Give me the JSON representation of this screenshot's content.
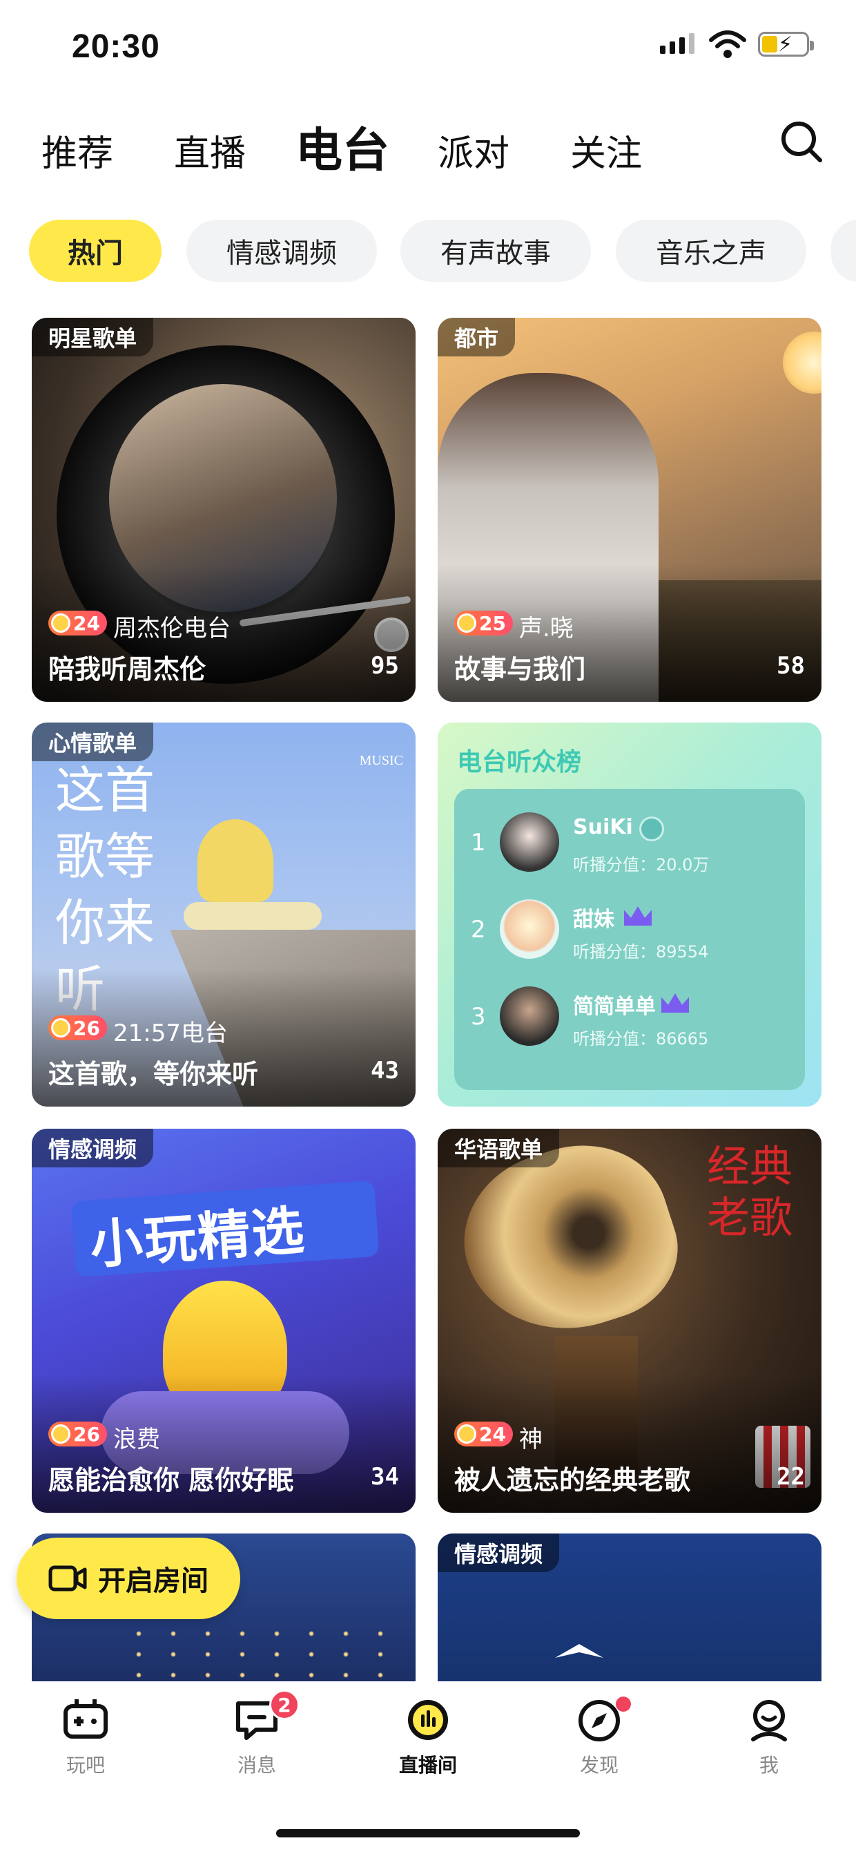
{
  "status_bar": {
    "time": "20:30"
  },
  "top_tabs": [
    {
      "label": "推荐"
    },
    {
      "label": "直播"
    },
    {
      "label": "电台"
    },
    {
      "label": "派对"
    },
    {
      "label": "关注"
    }
  ],
  "chips": [
    {
      "label": "热门"
    },
    {
      "label": "情感调频"
    },
    {
      "label": "有声故事"
    },
    {
      "label": "音乐之声"
    }
  ],
  "cards": [
    {
      "tag": "明星歌单",
      "level": "24",
      "host": "周杰伦电台",
      "title": "陪我听周杰伦",
      "count": "95"
    },
    {
      "tag": "都市",
      "level": "25",
      "host": "声.晓",
      "title": "故事与我们",
      "count": "58"
    },
    {
      "tag": "心情歌单",
      "level": "26",
      "host": "21:57电台",
      "title": "这首歌，等你来听",
      "count": "43",
      "art_text": "这首歌等你来听",
      "art_small": "MUSIC"
    },
    {
      "tag": "情感调频",
      "level": "26",
      "host": "浪费",
      "title": "愿能治愈你 愿你好眠",
      "count": "34",
      "art_text": "小玩精选"
    },
    {
      "tag": "华语歌单",
      "level": "24",
      "host": "神",
      "title": "被人遗忘的经典老歌",
      "count": "22",
      "art_text": "经典老歌"
    },
    {
      "tag": "情感调频"
    }
  ],
  "rank_card": {
    "title": "电台听众榜",
    "rows": [
      {
        "rank": "1",
        "name": "SuiKi",
        "score": "听播分值：20.0万"
      },
      {
        "rank": "2",
        "name": "甜妹",
        "score": "听播分值：89554"
      },
      {
        "rank": "3",
        "name": "简简单单",
        "score": "听播分值：86665"
      }
    ]
  },
  "open_room_button": {
    "label": "开启房间"
  },
  "bottom_nav": [
    {
      "label": "玩吧",
      "icon": "gamepad-icon"
    },
    {
      "label": "消息",
      "icon": "message-icon",
      "badge": "2"
    },
    {
      "label": "直播间",
      "icon": "live-room-icon"
    },
    {
      "label": "发现",
      "icon": "compass-icon"
    },
    {
      "label": "我",
      "icon": "profile-icon"
    }
  ],
  "colors": {
    "accent": "#ffe94a",
    "badge_red": "#f0445c",
    "rank_bg": "#7fcfc4"
  }
}
